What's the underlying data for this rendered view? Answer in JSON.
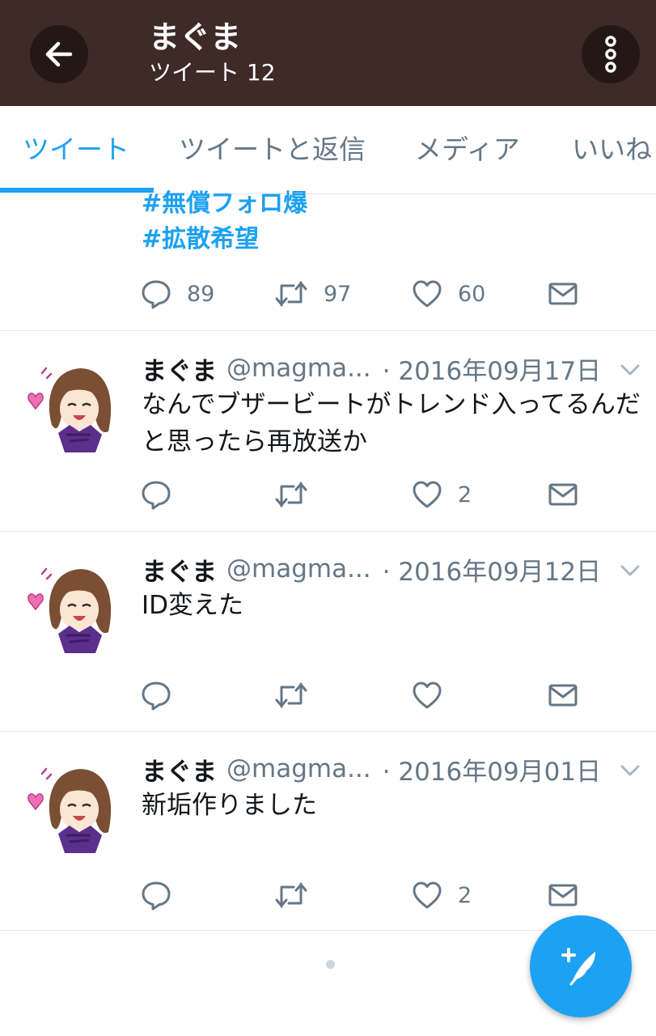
{
  "header": {
    "title": "まぐま",
    "subtitle": "ツイート 12",
    "background": "#3e2a26"
  },
  "tabs": [
    "ツイート",
    "ツイートと返信",
    "メディア",
    "いいね"
  ],
  "active_tab": "ツイート",
  "accent_color": "#1da1f2",
  "partial_tweet": {
    "hashtags": [
      "#無償フォロ爆",
      "#拡散希望"
    ],
    "reply_count": "89",
    "retweet_count": "97",
    "like_count": "60"
  },
  "tweets": [
    {
      "name": "まぐま",
      "handle": "@magma...",
      "date": "· 2016年09月17日",
      "text": "なんでブザービートがトレンド入ってるんだと思ったら再放送か",
      "like_count": "2"
    },
    {
      "name": "まぐま",
      "handle": "@magma...",
      "date": "· 2016年09月12日",
      "text": "ID変えた",
      "like_count": ""
    },
    {
      "name": "まぐま",
      "handle": "@magma...",
      "date": "· 2016年09月01日",
      "text": "新垢作りました",
      "like_count": "2"
    }
  ],
  "icons": {
    "back": "arrow-left-icon",
    "more": "more-vertical-icon",
    "reply": "reply-icon",
    "retweet": "retweet-icon",
    "like": "heart-icon",
    "dm": "envelope-icon",
    "compose": "compose-tweet-icon"
  }
}
